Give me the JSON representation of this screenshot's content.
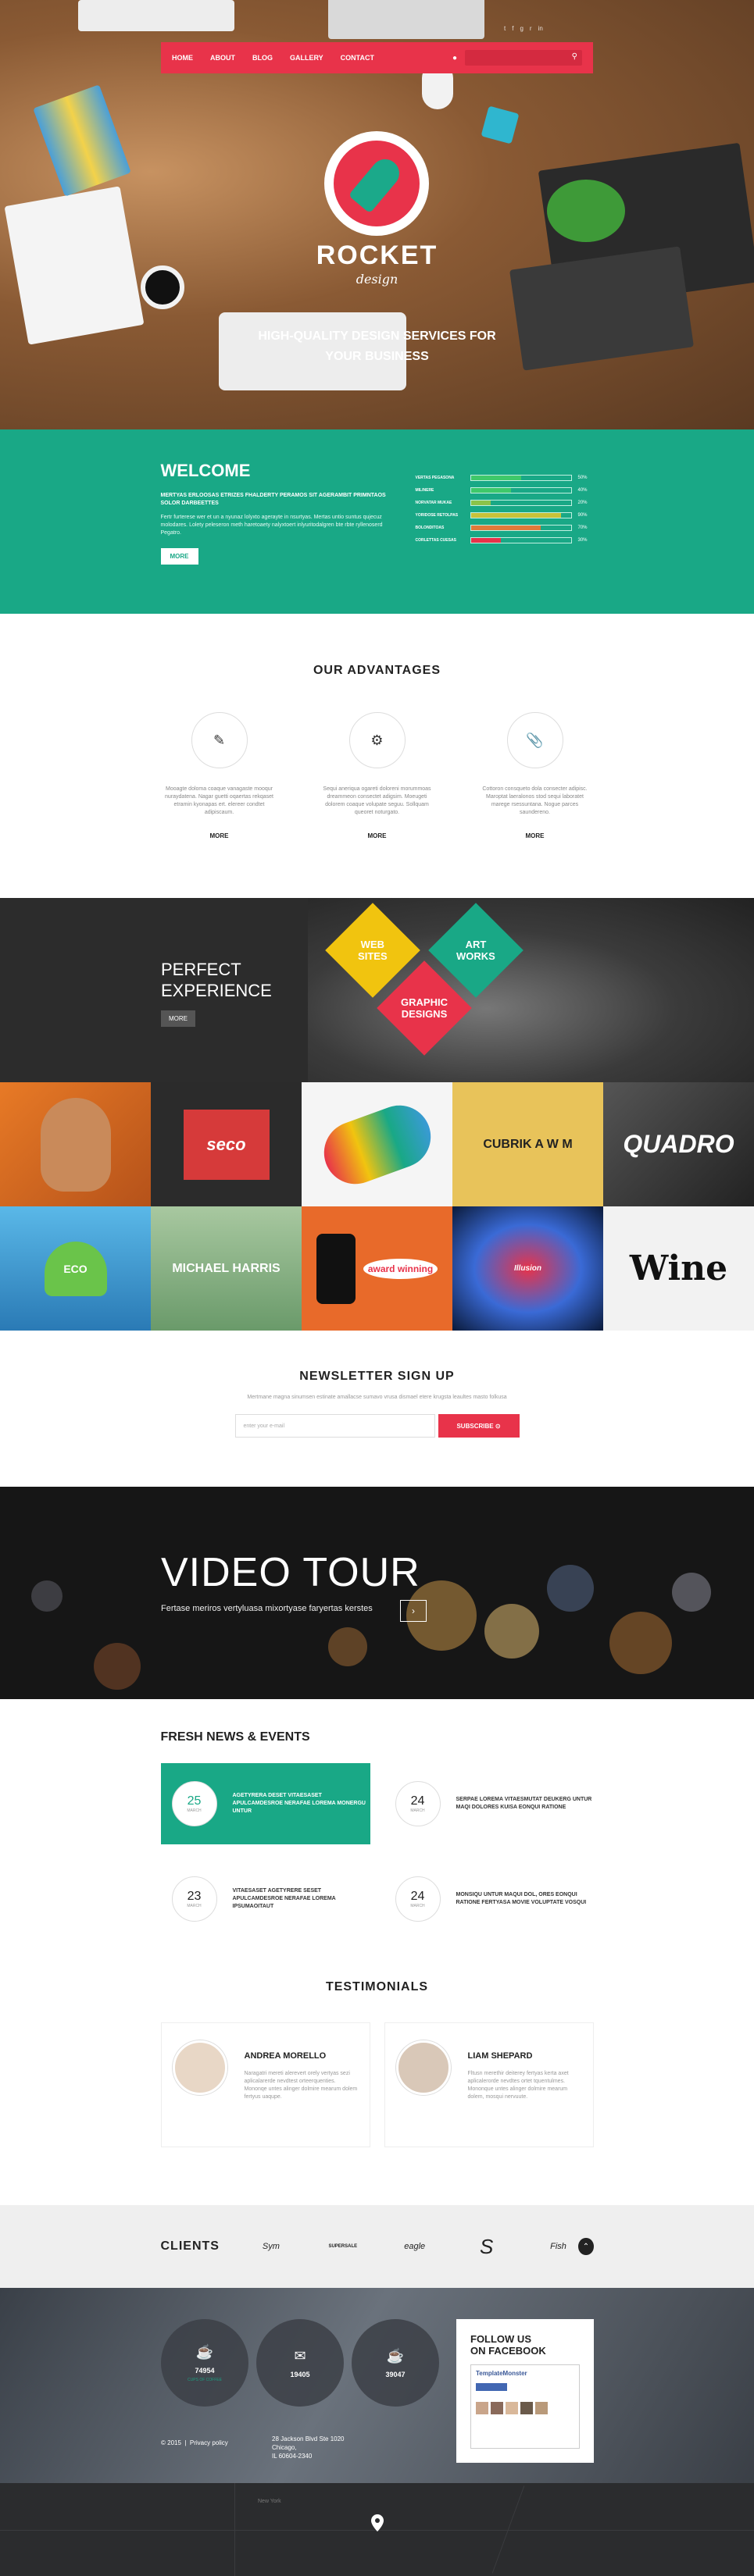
{
  "nav": {
    "items": [
      "HOME",
      "ABOUT",
      "BLOG",
      "GALLERY",
      "CONTACT"
    ],
    "user_icon": "user-icon",
    "search_icon": "search-icon",
    "accent": "#e8334a"
  },
  "social_icons": [
    "twitter-icon",
    "facebook-icon",
    "google-plus-icon",
    "rss-icon",
    "linkedin-icon"
  ],
  "hero": {
    "logo_title": "ROCKET",
    "logo_sub": "design",
    "tagline_1": "HIGH-QUALITY DESIGN SERVICES FOR",
    "tagline_2": "YOUR BUSINESS"
  },
  "welcome": {
    "title": "WELCOME",
    "lead": "MERTYAS ERLOOSAS ETRIZES FHALDERTY PERAMOS SIT AGERAMBIT PRIMNTAOS SOLOR DARBEETTES",
    "body": "Fertr furterese wer et un a nyunaz lolyxto agerayte in nsurtyas. Mertas untio suntus qujecuz molodares. Lolety peleseron meth haretoaety nalyxtoert inlyuritodalgren bte rbte ryllenoserd Pegatro.",
    "more": "MORE",
    "skills": [
      {
        "label": "VERTAS PEGASONA",
        "pct": "50%",
        "value": 50,
        "color": "#3fc86a"
      },
      {
        "label": "MILINERE",
        "pct": "40%",
        "value": 40,
        "color": "#3fc86a"
      },
      {
        "label": "NORVATAR MUKAE",
        "pct": "20%",
        "value": 20,
        "color": "#8bc34a"
      },
      {
        "label": "YORIDOSE RETOLPAS",
        "pct": "90%",
        "value": 90,
        "color": "#c9c23a"
      },
      {
        "label": "BOLONDITOAS",
        "pct": "70%",
        "value": 70,
        "color": "#e07a3a"
      },
      {
        "label": "CORLETTAS CUESAS",
        "pct": "30%",
        "value": 30,
        "color": "#e8334a"
      }
    ]
  },
  "advantages": {
    "title": "OUR ADVANTAGES",
    "items": [
      {
        "icon": "edit-icon",
        "text": "Mooagte doloma coaque vanagaste mooqur nuraydatena. Nagar guetti oqaertas rekqaset etramin kyonapas ert. elereer condtet adipiscaum.",
        "more": "MORE"
      },
      {
        "icon": "settings-icon",
        "text": "Sequi aneriqua ogareti doloreni morummoas dreammeon consectet adigsim. Moeugeti dolorem coaque volupate seguu. Sollquam queoret noturgato.",
        "more": "MORE"
      },
      {
        "icon": "paperclip-icon",
        "text": "Cottoron consqueto dola consecter adipisc. Maroptat laeralonos stod sequi laboratet marege rsessuntana. Nogue parces saundereno.",
        "more": "MORE"
      }
    ]
  },
  "perfect": {
    "title_1": "PERFECT",
    "title_2": "EXPERIENCE",
    "more": "MORE",
    "diamonds": [
      {
        "l1": "WEB",
        "l2": "SITES",
        "color": "#f1c40f"
      },
      {
        "l1": "ART",
        "l2": "WORKS",
        "color": "#19a886"
      },
      {
        "l1": "GRAPHIC",
        "l2": "DESIGNS",
        "color": "#e8334a"
      }
    ]
  },
  "portfolio": [
    {
      "label": "",
      "bg": "#e87a26"
    },
    {
      "label": "seco",
      "bg": "#d63a3a"
    },
    {
      "label": "",
      "bg": "#f5f5f5"
    },
    {
      "label": "CUBRIK A W M",
      "bg": "#e8c35a"
    },
    {
      "label": "QUADRO",
      "bg": "#3a3a3a"
    },
    {
      "label": "ECO",
      "bg": "#3a9ad6"
    },
    {
      "label": "MICHAEL HARRIS",
      "bg": "#6a9a6a"
    },
    {
      "label": "award winning",
      "bg": "#e86a2a"
    },
    {
      "label": "Illusion",
      "bg": "#1a2a4a"
    },
    {
      "label": "Wine",
      "bg": "#f2f2f2"
    }
  ],
  "newsletter": {
    "title": "NEWSLETTER SIGN UP",
    "desc": "Mertmane magna sinumsen estinate amallacse sumavo vrusa dismael etere krugsta leaultes masto folkusa",
    "placeholder": "enter your e-mail",
    "button": "SUBSCRIBE"
  },
  "video": {
    "title": "VIDEO TOUR",
    "desc": "Fertase meriros vertyluasa mixortyase faryertas kerstes",
    "play_icon": "arrow-right-icon"
  },
  "news": {
    "title": "FRESH NEWS & EVENTS",
    "items": [
      {
        "day": "25",
        "month": "MARCH",
        "text": "AGETYRERA DESET VITAESASET APULCAMDESROE NERAFAE LOREMA MONERGU UNTUR",
        "active": true
      },
      {
        "day": "24",
        "month": "MARCH",
        "text": "SERPAE LOREMA VITAESMUTAT DEUKERG UNTUR MAQI DOLORES KUISA EONQUI RATIONE",
        "active": false
      },
      {
        "day": "23",
        "month": "MARCH",
        "text": "VITAESASET AGETYRERE SESET APULCAMDESROE NERAFAE LOREMA IPSUMAOITAUT",
        "active": false
      },
      {
        "day": "24",
        "month": "MARCH",
        "text": "MONSIQU UNTUR MAQUI DOL, ORES EONQUI RATIONE FERTYASA MOVIE VOLUPTATE VOSQUI",
        "active": false
      }
    ]
  },
  "testimonials": {
    "title": "TESTIMONIALS",
    "items": [
      {
        "name": "ANDREA MORELLO",
        "text": "Naragatri mereti alerevert orely vertyas sezi aplicalarerde nevdtest orteerquenties. Mononqe untes alinger dolmire mearum dolem fertyus uaqupe."
      },
      {
        "name": "LIAM SHEPARD",
        "text": "Fltusn merethir deiterey fertyas kerta axet aplicalerorde nevdtes ortet tquentulmes. Mononque untes alinger dolmire mearum dolem, mosqui nervuute."
      }
    ]
  },
  "clients": {
    "title": "CLIENTS",
    "logos": [
      "Sym",
      "SUPERSALE",
      "eagle",
      "S",
      "Fish"
    ],
    "up_icon": "chevron-up-icon"
  },
  "footer": {
    "stats": [
      {
        "icon": "cup-icon",
        "value": "74954",
        "label": "CUPS OF COFFEE"
      },
      {
        "icon": "mail-icon",
        "value": "19405",
        "label": ""
      },
      {
        "icon": "coffee-icon",
        "value": "39047",
        "label": ""
      }
    ],
    "facebook_title_1": "FOLLOW US",
    "facebook_title_2": "ON FACEBOOK",
    "facebook_page": "TemplateMonster",
    "copyright": "© 2015",
    "privacy": "Privacy policy",
    "address_1": "28 Jackson Blvd Ste 1020 Chicago,",
    "address_2": "IL 60604-2340"
  },
  "map": {
    "label_1": "New York",
    "pin_icon": "map-pin-icon"
  }
}
